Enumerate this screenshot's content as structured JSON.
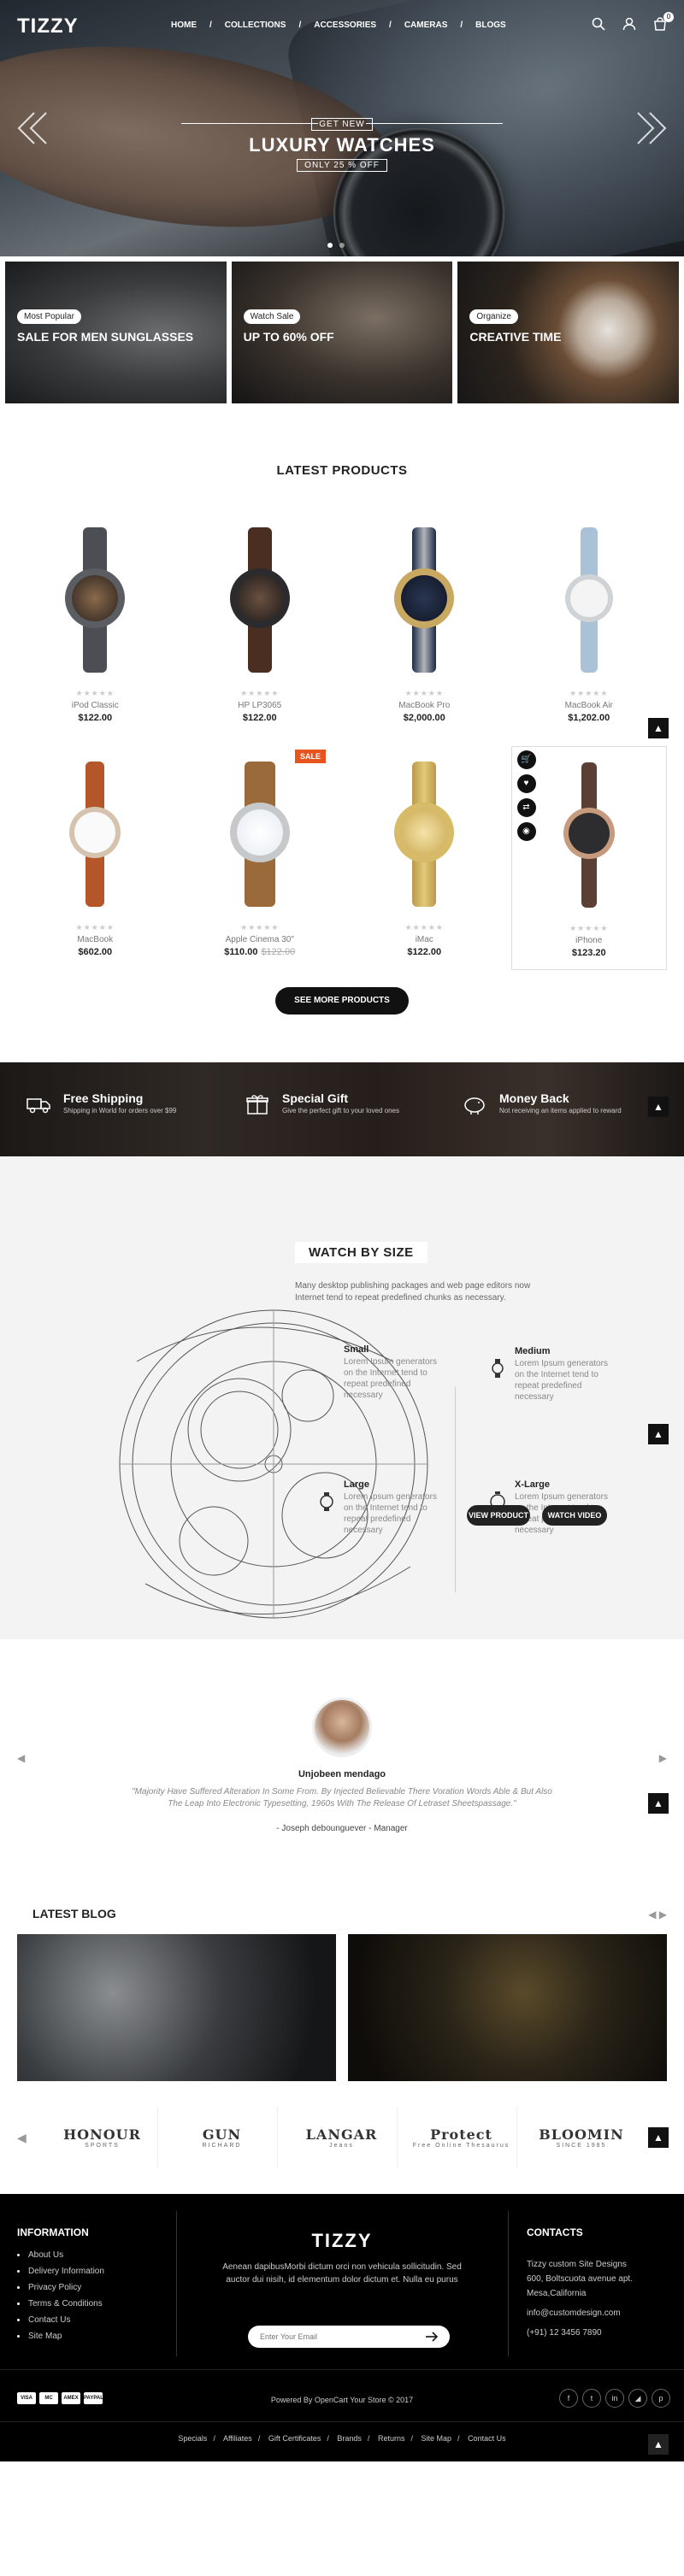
{
  "brand": "TIZZY",
  "nav": [
    "HOME",
    "COLLECTIONS",
    "ACCESSORIES",
    "CAMERAS",
    "BLOGS"
  ],
  "cart_count": "0",
  "hero": {
    "get": "GET NEW",
    "title": "LUXURY WATCHES",
    "sub": "ONLY 25 % OFF"
  },
  "banners": [
    {
      "tag": "Most Popular",
      "title": "SALE FOR MEN SUNGLASSES"
    },
    {
      "tag": "Watch Sale",
      "title": "UP TO 60% OFF"
    },
    {
      "tag": "Organize",
      "title": "CREATIVE TIME"
    }
  ],
  "latest_title": "LATEST PRODUCTS",
  "products": [
    {
      "name": "iPod Classic",
      "price": "$122.00",
      "old": ""
    },
    {
      "name": "HP LP3065",
      "price": "$122.00",
      "old": ""
    },
    {
      "name": "MacBook Pro",
      "price": "$2,000.00",
      "old": ""
    },
    {
      "name": "MacBook Air",
      "price": "$1,202.00",
      "old": ""
    },
    {
      "name": "MacBook",
      "price": "$602.00",
      "old": ""
    },
    {
      "name": "Apple Cinema 30\"",
      "price": "$110.00",
      "old": "$122.00"
    },
    {
      "name": "iMac",
      "price": "$122.00",
      "old": ""
    },
    {
      "name": "iPhone",
      "price": "$123.20",
      "old": ""
    }
  ],
  "sale_badge": "SALE",
  "see_more": "SEE MORE PRODUCTS",
  "features": [
    {
      "title": "Free Shipping",
      "text": "Shipping in World for orders over $99"
    },
    {
      "title": "Special Gift",
      "text": "Give the perfect gift to your loved ones"
    },
    {
      "title": "Money Back",
      "text": "Not receiving an items applied to reward"
    }
  ],
  "wbs": {
    "title": "WATCH BY SIZE",
    "intro": "Many desktop publishing packages and web page editors now Internet tend to repeat predefined chunks as necessary.",
    "sizes": [
      {
        "name": "Small",
        "text": "Lorem Ipsum generators on the Internet tend to repeat predefined necessary"
      },
      {
        "name": "Medium",
        "text": "Lorem Ipsum generators on the Internet tend to repeat predefined necessary"
      },
      {
        "name": "Large",
        "text": "Lorem Ipsum generators on the Internet tend to repeat predefined necessary"
      },
      {
        "name": "X-Large",
        "text": "Lorem Ipsum generators on the Internet tend to repeat predefined necessary"
      }
    ],
    "view_product": "VIEW PRODUCT",
    "watch_video": "WATCH VIDEO"
  },
  "testimonial": {
    "name": "Unjobeen mendago",
    "quote": "\"Majority Have Suffered Alteration In Some From. By Injected Believable There Voration Words Able & But Also The Leap Into Electronic Typesetting, 1960s With The Release Of Letraset Sheetspassage.\"",
    "author": "- Joseph debounguever - Manager"
  },
  "blog_title": "LATEST BLOG",
  "brands": [
    {
      "name": "HONOUR",
      "sub": "SPORTS"
    },
    {
      "name": "GUN",
      "sub": "RICHARD"
    },
    {
      "name": "LANGAR",
      "sub": "Jeans"
    },
    {
      "name": "Protect",
      "sub": "Free Online Thesaurus"
    },
    {
      "name": "BLOOMIN",
      "sub": "SINCE 1985"
    }
  ],
  "footer": {
    "info_title": "INFORMATION",
    "links": [
      "About Us",
      "Delivery Information",
      "Privacy Policy",
      "Terms & Conditions",
      "Contact Us",
      "Site Map"
    ],
    "logo": "TIZZY",
    "desc": "Aenean dapibusMorbi dictum orci non vehicula sollicitudin. Sed auctor dui nisih, id elementum dolor dictum et. Nulla eu purus",
    "email_placeholder": "Enter Your Email",
    "contacts_title": "CONTACTS",
    "contacts": [
      "Tizzy custom Site Designs",
      "600, Boltscuota avenue apt.",
      "Mesa,California",
      "info@customdesign.com",
      "(+91) 12 3456 7890"
    ],
    "payments": [
      "VISA",
      "MC",
      "AMEX",
      "PAYPAL"
    ],
    "powered": "Powered By OpenCart Your Store © 2017",
    "bottom_links": [
      "Specials",
      "Affiliates",
      "Gift Certificates",
      "Brands",
      "Returns",
      "Site Map",
      "Contact Us"
    ]
  }
}
